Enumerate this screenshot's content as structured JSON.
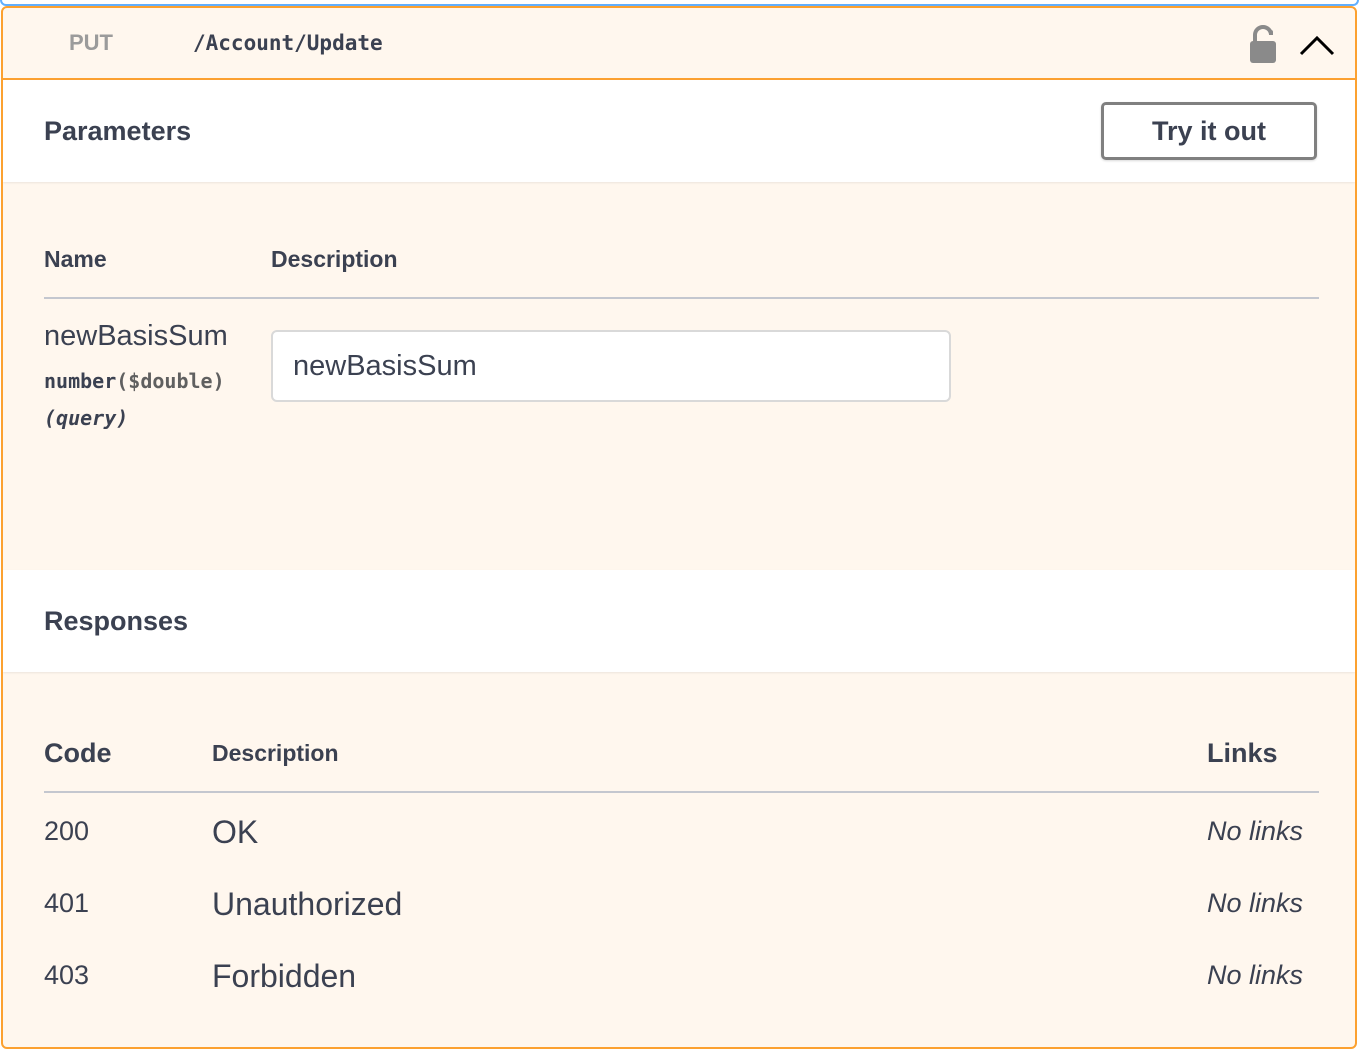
{
  "operation": {
    "method": "PUT",
    "path": "/Account/Update"
  },
  "parameters": {
    "title": "Parameters",
    "try_label": "Try it out",
    "columns": {
      "name": "Name",
      "description": "Description"
    },
    "items": [
      {
        "name": "newBasisSum",
        "type": "number",
        "format": "($double)",
        "in": "(query)",
        "placeholder": "newBasisSum"
      }
    ]
  },
  "responses": {
    "title": "Responses",
    "columns": {
      "code": "Code",
      "description": "Description",
      "links": "Links"
    },
    "rows": [
      {
        "code": "200",
        "description": "OK",
        "links": "No links"
      },
      {
        "code": "401",
        "description": "Unauthorized",
        "links": "No links"
      },
      {
        "code": "403",
        "description": "Forbidden",
        "links": "No links"
      }
    ]
  },
  "colors": {
    "put_accent": "#fca130",
    "background": "#fff7ee",
    "text": "#3b4151"
  },
  "icons": {
    "lock": "lock-icon",
    "collapse": "chevron-up-icon"
  }
}
